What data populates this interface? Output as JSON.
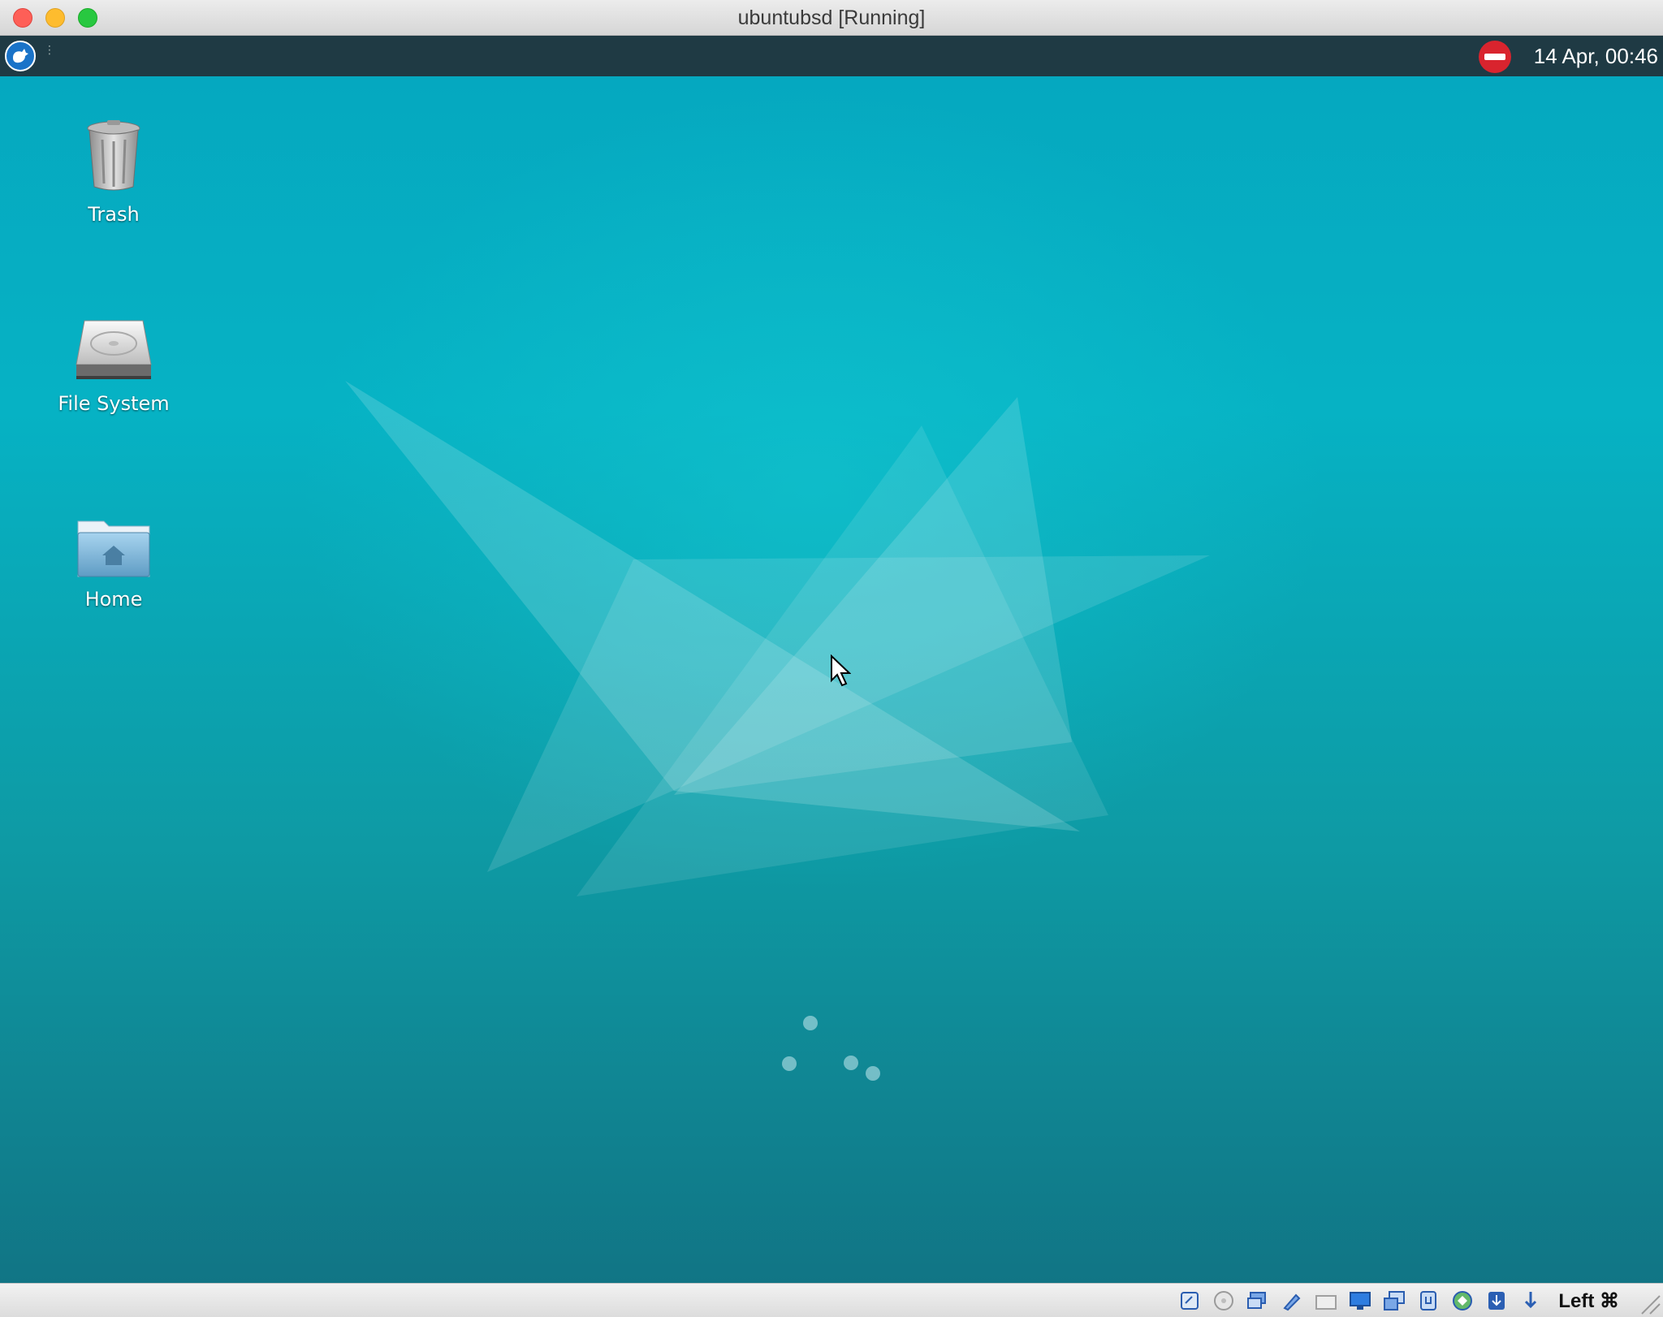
{
  "window": {
    "title": "ubuntubsd [Running]"
  },
  "panel": {
    "clock": "14 Apr, 00:46",
    "menu_icon": "xfce-whisker-menu-icon",
    "notification_icon": "do-not-disturb-icon"
  },
  "desktop": {
    "icons": [
      {
        "label": "Trash",
        "icon": "trash-icon"
      },
      {
        "label": "File System",
        "icon": "hard-drive-icon"
      },
      {
        "label": "Home",
        "icon": "home-folder-icon"
      }
    ]
  },
  "statusbar": {
    "icons": [
      "hard-disk-status-icon",
      "optical-drive-icon",
      "audio-icon",
      "network-icon",
      "shared-folders-icon",
      "display-icon",
      "video-capture-icon",
      "usb-icon",
      "cpu-icon",
      "mouse-integration-icon",
      "download-arrow-icon"
    ],
    "host_key": "Left ⌘"
  },
  "colors": {
    "wallpaper_top": "#05a7bf",
    "wallpaper_bottom": "#117585",
    "panel": "#1f3a44"
  }
}
